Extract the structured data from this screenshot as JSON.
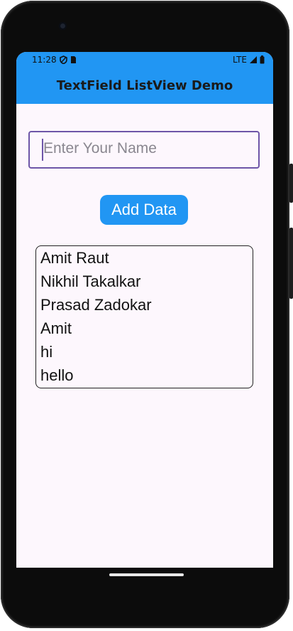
{
  "status_bar": {
    "time": "11:28",
    "network": "LTE"
  },
  "app_bar": {
    "title": "TextField ListView Demo"
  },
  "name_input": {
    "placeholder": "Enter Your Name",
    "value": ""
  },
  "add_button": {
    "label": "Add Data"
  },
  "list": {
    "items": [
      "Amit Raut",
      "Nikhil Takalkar",
      "Prasad Zadokar",
      "Amit",
      "hi",
      "hello"
    ]
  },
  "colors": {
    "primary": "#2196f3",
    "background": "#fdf7fd",
    "input_border": "#6e56a8"
  }
}
